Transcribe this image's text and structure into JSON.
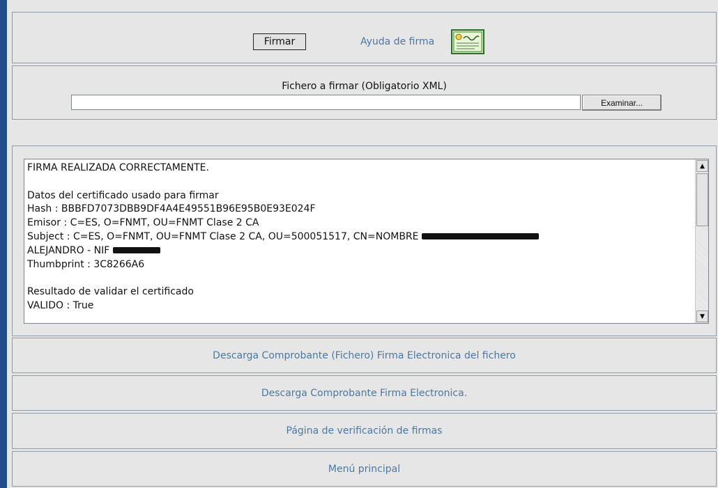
{
  "sign_panel": {
    "sign_button": "Firmar",
    "help_link": "Ayuda de firma",
    "help_icon": "certificate-icon"
  },
  "file_panel": {
    "label": "Fichero a firmar (Obligatorio XML)",
    "input_value": "",
    "browse_button": "Examinar..."
  },
  "result": {
    "lines": [
      "FIRMA REALIZADA CORRECTAMENTE.",
      "",
      "Datos del certificado usado para firmar",
      "Hash : BBBFD7073DBB9DF4A4E49551B96E95B0E93E024F",
      "Emisor : C=ES, O=FNMT, OU=FNMT Clase 2 CA",
      "Subject : C=ES, O=FNMT, OU=FNMT Clase 2 CA, OU=500051517, CN=NOMBRE",
      "ALEJANDRO - NIF",
      "Thumbprint : 3C8266A6",
      "",
      "Resultado de validar el certificado",
      "VALIDO : True"
    ]
  },
  "links": {
    "download_file_receipt": "Descarga Comprobante (Fichero) Firma Electronica del fichero",
    "download_receipt": "Descarga Comprobante Firma Electronica.",
    "verification_page": "Página de verificación de firmas",
    "main_menu": "Menú principal"
  }
}
